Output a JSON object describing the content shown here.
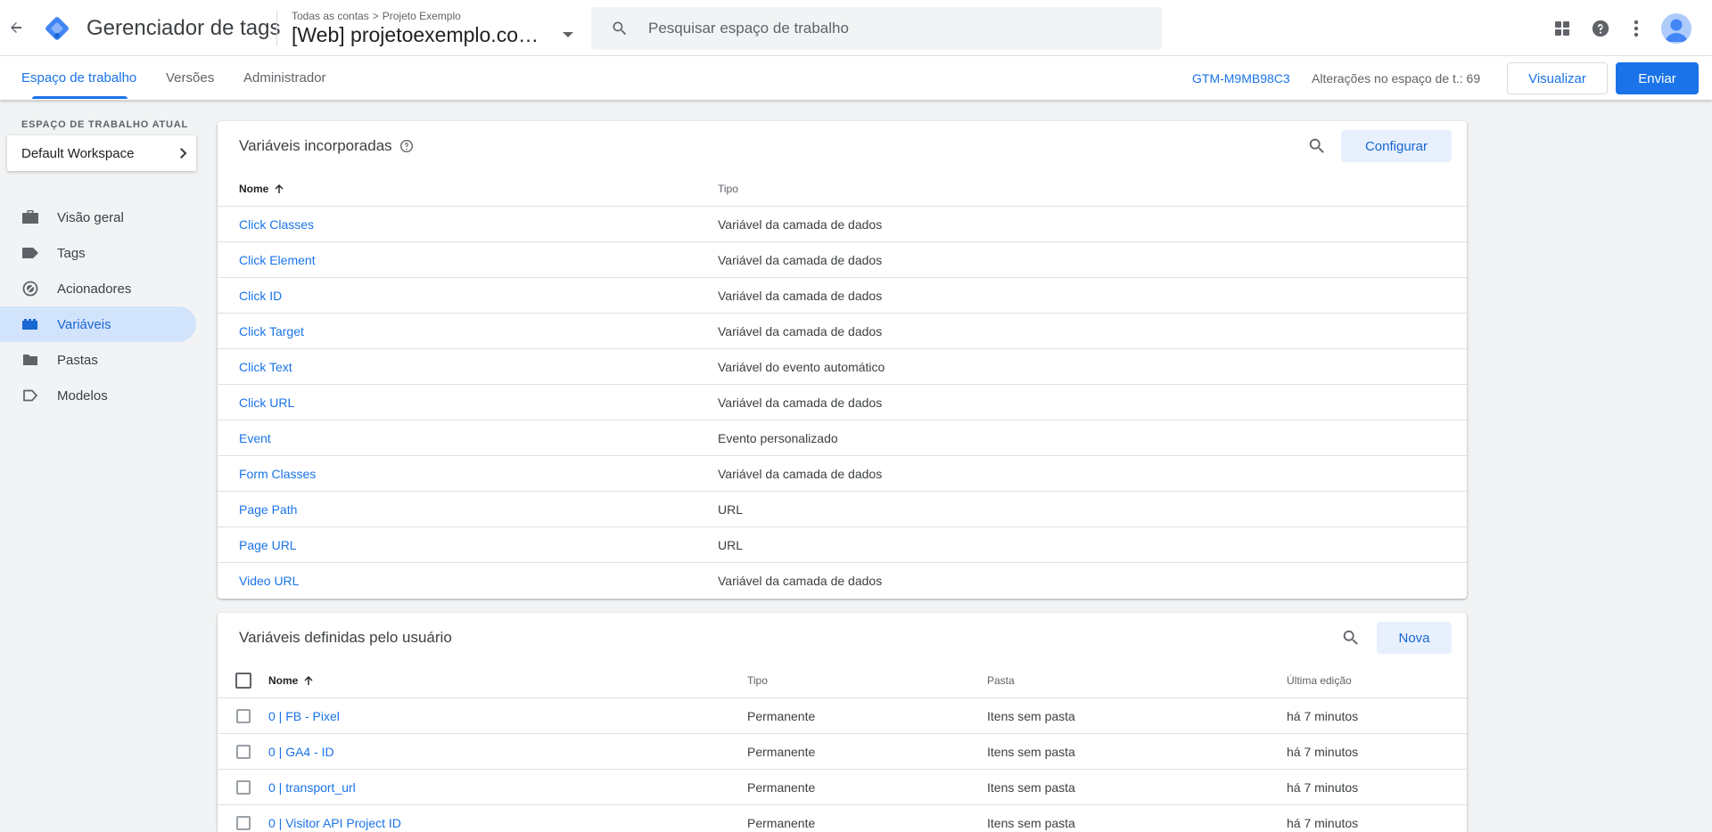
{
  "header": {
    "app_title": "Gerenciador de tags",
    "breadcrumb_root": "Todas as contas",
    "breadcrumb_separator": ">",
    "breadcrumb_account": "Projeto Exemplo",
    "container_name": "[Web] projetoexemplo.com.br",
    "search_placeholder": "Pesquisar espaço de trabalho"
  },
  "nav": {
    "tabs": [
      "Espaço de trabalho",
      "Versões",
      "Administrador"
    ],
    "active_tab": "Espaço de trabalho",
    "container_id": "GTM-M9MB98C3",
    "changes_text": "Alterações no espaço de t.: 69",
    "preview_label": "Visualizar",
    "submit_label": "Enviar"
  },
  "sidebar": {
    "workspace_label": "ESPAÇO DE TRABALHO ATUAL",
    "workspace_name": "Default Workspace",
    "items": [
      {
        "label": "Visão geral",
        "icon": "briefcase-icon"
      },
      {
        "label": "Tags",
        "icon": "tag-icon"
      },
      {
        "label": "Acionadores",
        "icon": "trigger-icon"
      },
      {
        "label": "Variáveis",
        "icon": "variables-icon"
      },
      {
        "label": "Pastas",
        "icon": "folder-icon"
      },
      {
        "label": "Modelos",
        "icon": "template-icon"
      }
    ],
    "active_item": "Variáveis"
  },
  "builtin": {
    "title": "Variáveis incorporadas",
    "configure_label": "Configurar",
    "col_name": "Nome",
    "col_type": "Tipo",
    "rows": [
      {
        "name": "Click Classes",
        "type": "Variável da camada de dados"
      },
      {
        "name": "Click Element",
        "type": "Variável da camada de dados"
      },
      {
        "name": "Click ID",
        "type": "Variável da camada de dados"
      },
      {
        "name": "Click Target",
        "type": "Variável da camada de dados"
      },
      {
        "name": "Click Text",
        "type": "Variável do evento automático"
      },
      {
        "name": "Click URL",
        "type": "Variável da camada de dados"
      },
      {
        "name": "Event",
        "type": "Evento personalizado"
      },
      {
        "name": "Form Classes",
        "type": "Variável da camada de dados"
      },
      {
        "name": "Page Path",
        "type": "URL"
      },
      {
        "name": "Page URL",
        "type": "URL"
      },
      {
        "name": "Video URL",
        "type": "Variável da camada de dados"
      }
    ]
  },
  "user_defined": {
    "title": "Variáveis definidas pelo usuário",
    "new_label": "Nova",
    "col_name": "Nome",
    "col_type": "Tipo",
    "col_folder": "Pasta",
    "col_edited": "Última edição",
    "rows": [
      {
        "name": "0 | FB - Pixel",
        "type": "Permanente",
        "folder": "Itens sem pasta",
        "edited": "há 7 minutos"
      },
      {
        "name": "0 | GA4 - ID",
        "type": "Permanente",
        "folder": "Itens sem pasta",
        "edited": "há 7 minutos"
      },
      {
        "name": "0 | transport_url",
        "type": "Permanente",
        "folder": "Itens sem pasta",
        "edited": "há 7 minutos"
      },
      {
        "name": "0 | Visitor API Project ID",
        "type": "Permanente",
        "folder": "Itens sem pasta",
        "edited": "há 7 minutos"
      }
    ]
  },
  "colors": {
    "accent": "#1a73e8",
    "active_nav_bg": "#d2e3fc",
    "logo_blue": "#4285f4",
    "logo_light": "#8ab4f8"
  }
}
